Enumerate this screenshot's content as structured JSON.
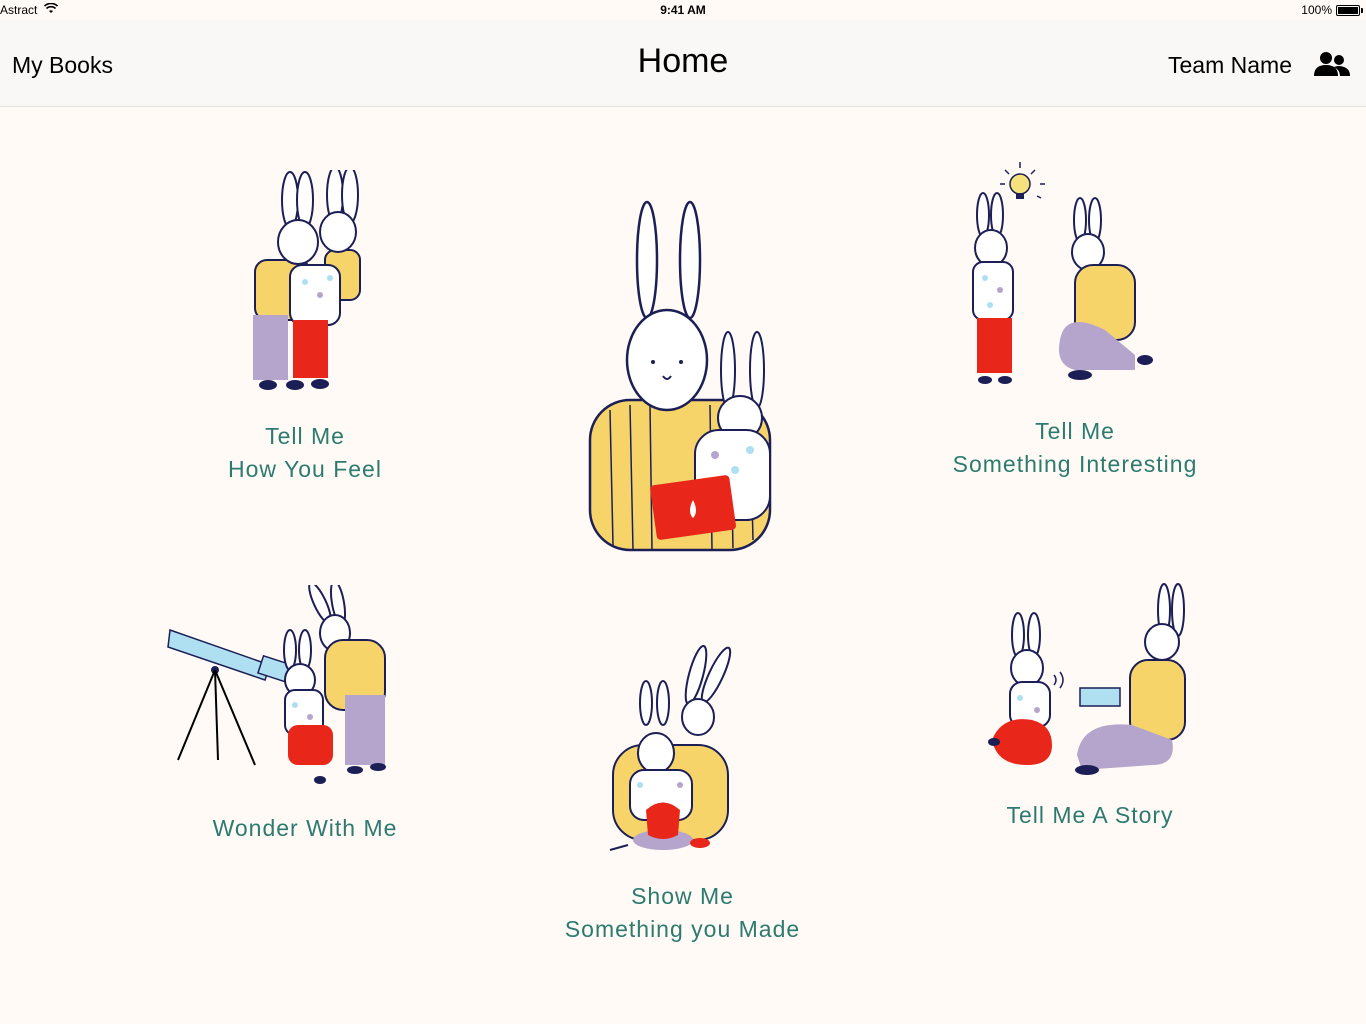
{
  "status_bar": {
    "carrier": "Astract",
    "time": "9:41 AM",
    "battery": "100%"
  },
  "nav": {
    "left": "My Books",
    "title": "Home",
    "right": "Team Name"
  },
  "tiles": [
    {
      "line1": "Tell Me",
      "line2": "How You Feel"
    },
    {
      "line1": "Tell Me",
      "line2": "Something Interesting"
    },
    {
      "line1": "Wonder With Me"
    },
    {
      "line1": "Show Me",
      "line2": "Something you Made"
    },
    {
      "line1": "Tell Me A Story"
    }
  ],
  "colors": {
    "accent": "#2d7a6e",
    "yellow": "#f6d46a",
    "red": "#e8271a",
    "lavender": "#b5a4cc",
    "outline": "#1c1f55",
    "sky": "#aee0f2"
  }
}
